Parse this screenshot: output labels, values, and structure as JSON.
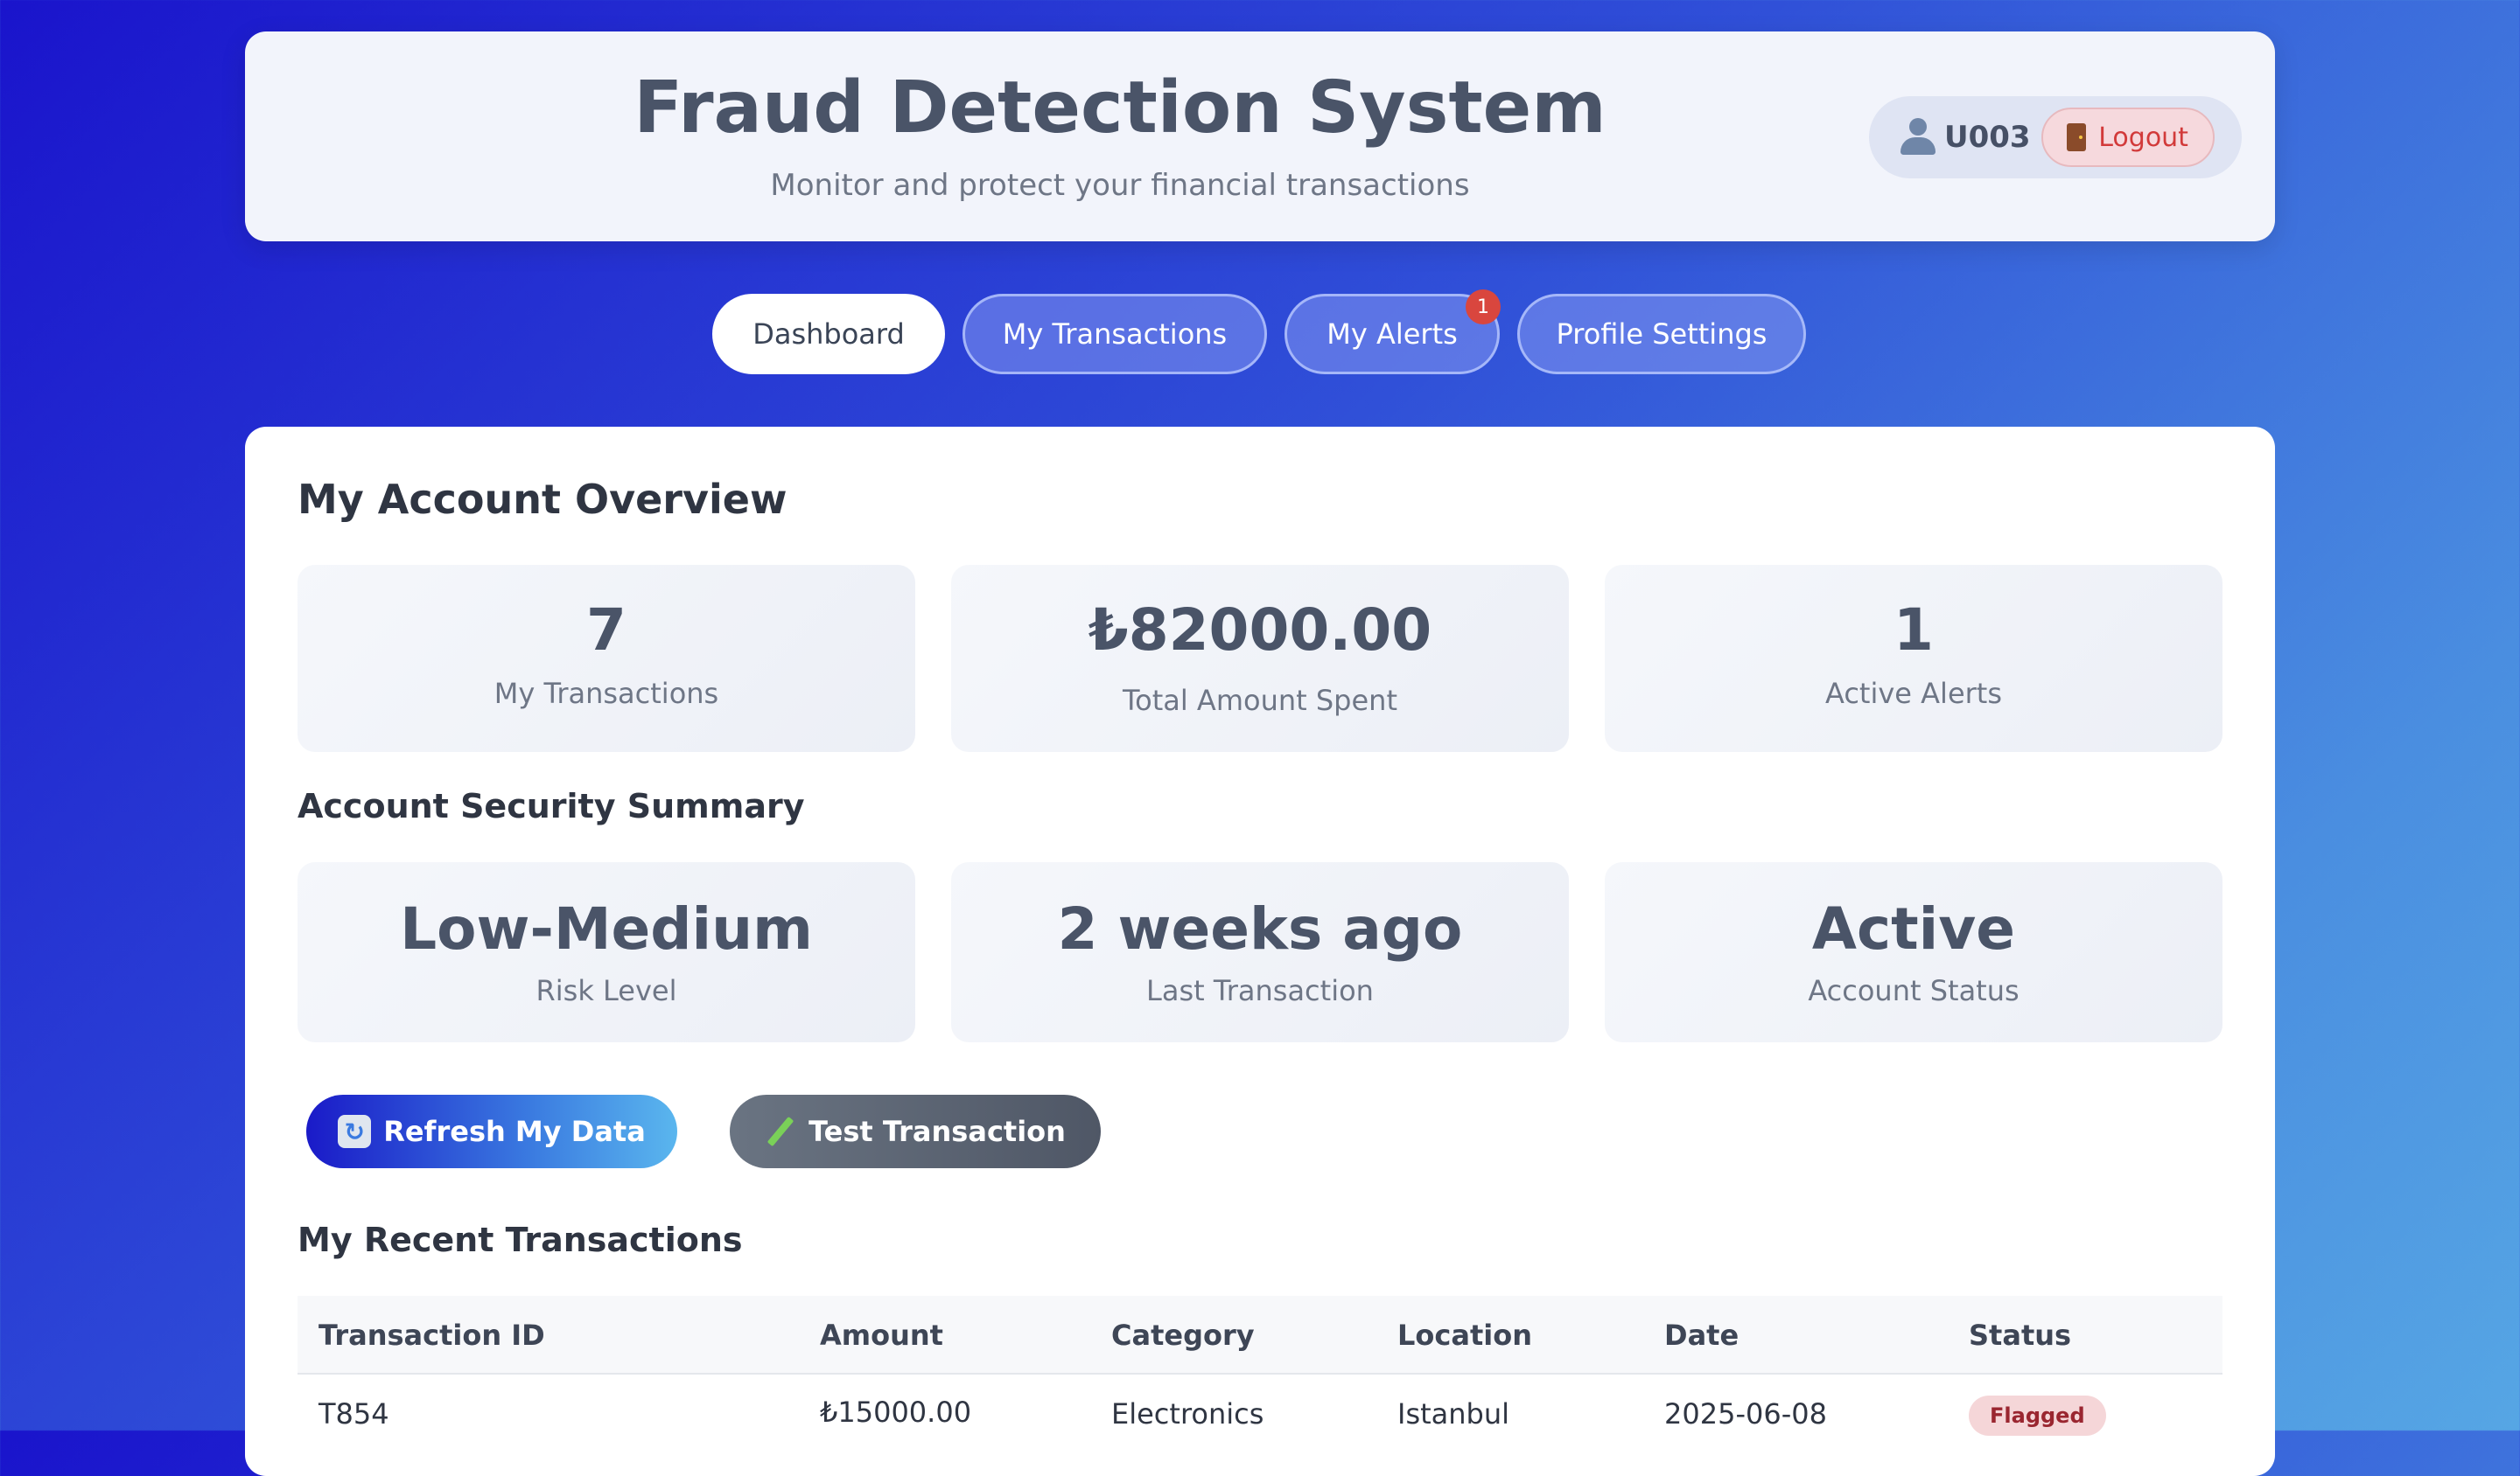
{
  "header": {
    "title": "Fraud Detection System",
    "subtitle": "Monitor and protect your financial transactions",
    "user_id": "U003",
    "logout_label": "Logout"
  },
  "nav": {
    "tabs": [
      {
        "label": "Dashboard",
        "active": true
      },
      {
        "label": "My Transactions",
        "active": false
      },
      {
        "label": "My Alerts",
        "active": false,
        "badge": "1"
      },
      {
        "label": "Profile Settings",
        "active": false
      }
    ]
  },
  "overview": {
    "title": "My Account Overview",
    "cards": [
      {
        "value": "7",
        "label": "My Transactions"
      },
      {
        "value": "₺82000.00",
        "label": "Total Amount Spent"
      },
      {
        "value": "1",
        "label": "Active Alerts"
      }
    ]
  },
  "security": {
    "title": "Account Security Summary",
    "cards": [
      {
        "value": "Low-Medium",
        "label": "Risk Level"
      },
      {
        "value": "2 weeks ago",
        "label": "Last Transaction"
      },
      {
        "value": "Active",
        "label": "Account Status"
      }
    ]
  },
  "actions": {
    "refresh_label": "Refresh My Data",
    "test_label": "Test Transaction"
  },
  "recent": {
    "title": "My Recent Transactions",
    "columns": [
      "Transaction ID",
      "Amount",
      "Category",
      "Location",
      "Date",
      "Status"
    ],
    "rows": [
      {
        "id": "T854",
        "amount": "₺15000.00",
        "category": "Electronics",
        "location": "Istanbul",
        "date": "2025-06-08",
        "status": "Flagged"
      }
    ]
  },
  "colors": {
    "accent": "#3050d8",
    "flagged_bg": "#f5d6d8",
    "flagged_text": "#9a2630",
    "logout": "#d23a3a"
  },
  "icons": [
    "user-icon",
    "door-icon",
    "refresh-icon",
    "pencil-icon"
  ]
}
